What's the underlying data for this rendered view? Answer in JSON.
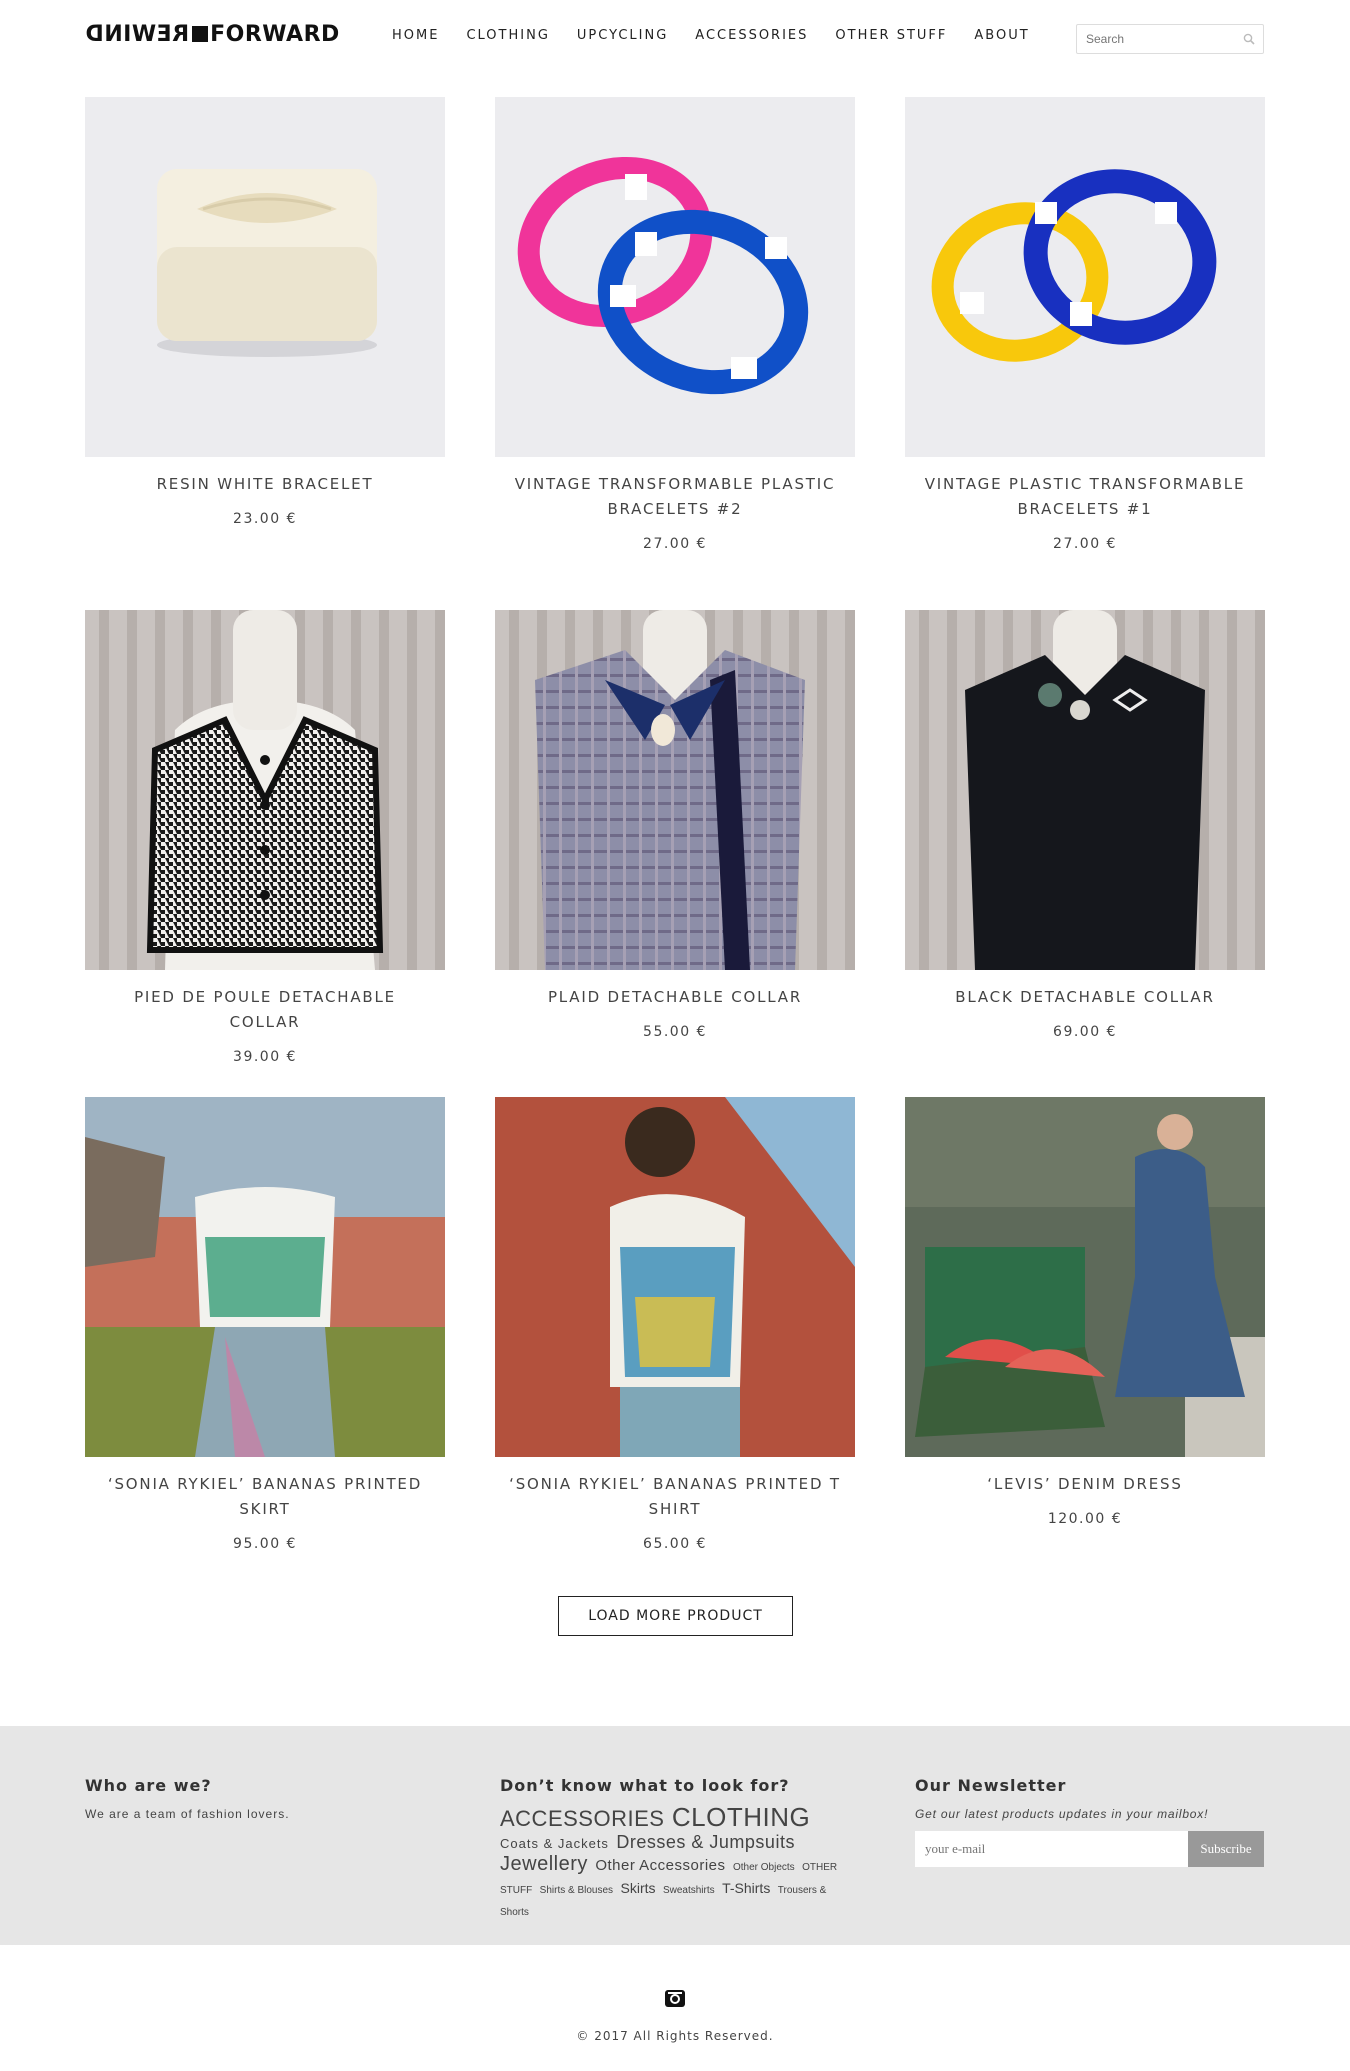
{
  "header": {
    "logo_left": "REWIND",
    "logo_right": "FORWARD",
    "nav": [
      "HOME",
      "CLOTHING",
      "UPCYCLING",
      "ACCESSORIES",
      "OTHER STUFF",
      "ABOUT"
    ],
    "search_placeholder": "Search"
  },
  "products": [
    {
      "name": "RESIN WHITE BRACELET",
      "price": "23.00 €"
    },
    {
      "name": "VINTAGE TRANSFORMABLE PLASTIC BRACELETS #2",
      "price": "27.00 €"
    },
    {
      "name": "VINTAGE PLASTIC TRANSFORMABLE BRACELETS #1",
      "price": "27.00 €"
    },
    {
      "name": "PIED DE POULE DETACHABLE COLLAR",
      "price": "39.00 €"
    },
    {
      "name": "PLAID DETACHABLE COLLAR",
      "price": "55.00 €"
    },
    {
      "name": "BLACK DETACHABLE COLLAR",
      "price": "69.00 €"
    },
    {
      "name": "‘SONIA RYKIEL’ BANANAS PRINTED SKIRT",
      "price": "95.00 €"
    },
    {
      "name": "‘SONIA RYKIEL’ BANANAS PRINTED T SHIRT",
      "price": "65.00 €"
    },
    {
      "name": "‘LEVIS’ DENIM DRESS",
      "price": "120.00 €"
    }
  ],
  "load_more": "LOAD MORE PRODUCT",
  "footer": {
    "about_title": "Who are we?",
    "about_text": "We are a team of fashion lovers.",
    "tags_title": "Don’t know what to look for?",
    "tags": [
      "ACCESSORIES",
      "CLOTHING",
      "Coats & Jackets",
      "Dresses & Jumpsuits",
      "Jewellery",
      "Other Accessories",
      "Other Objects",
      "OTHER STUFF",
      "Shirts & Blouses",
      "Skirts",
      "Sweatshirts",
      "T-Shirts",
      "Trousers & Shorts"
    ],
    "newsletter_title": "Our Newsletter",
    "newsletter_text": "Get our latest products updates in your mailbox!",
    "email_placeholder": "your e-mail",
    "subscribe": "Subscribe"
  },
  "copyright": "© 2017 All Rights Reserved.",
  "icons": {
    "search": "search-icon",
    "instagram": "instagram-icon"
  }
}
